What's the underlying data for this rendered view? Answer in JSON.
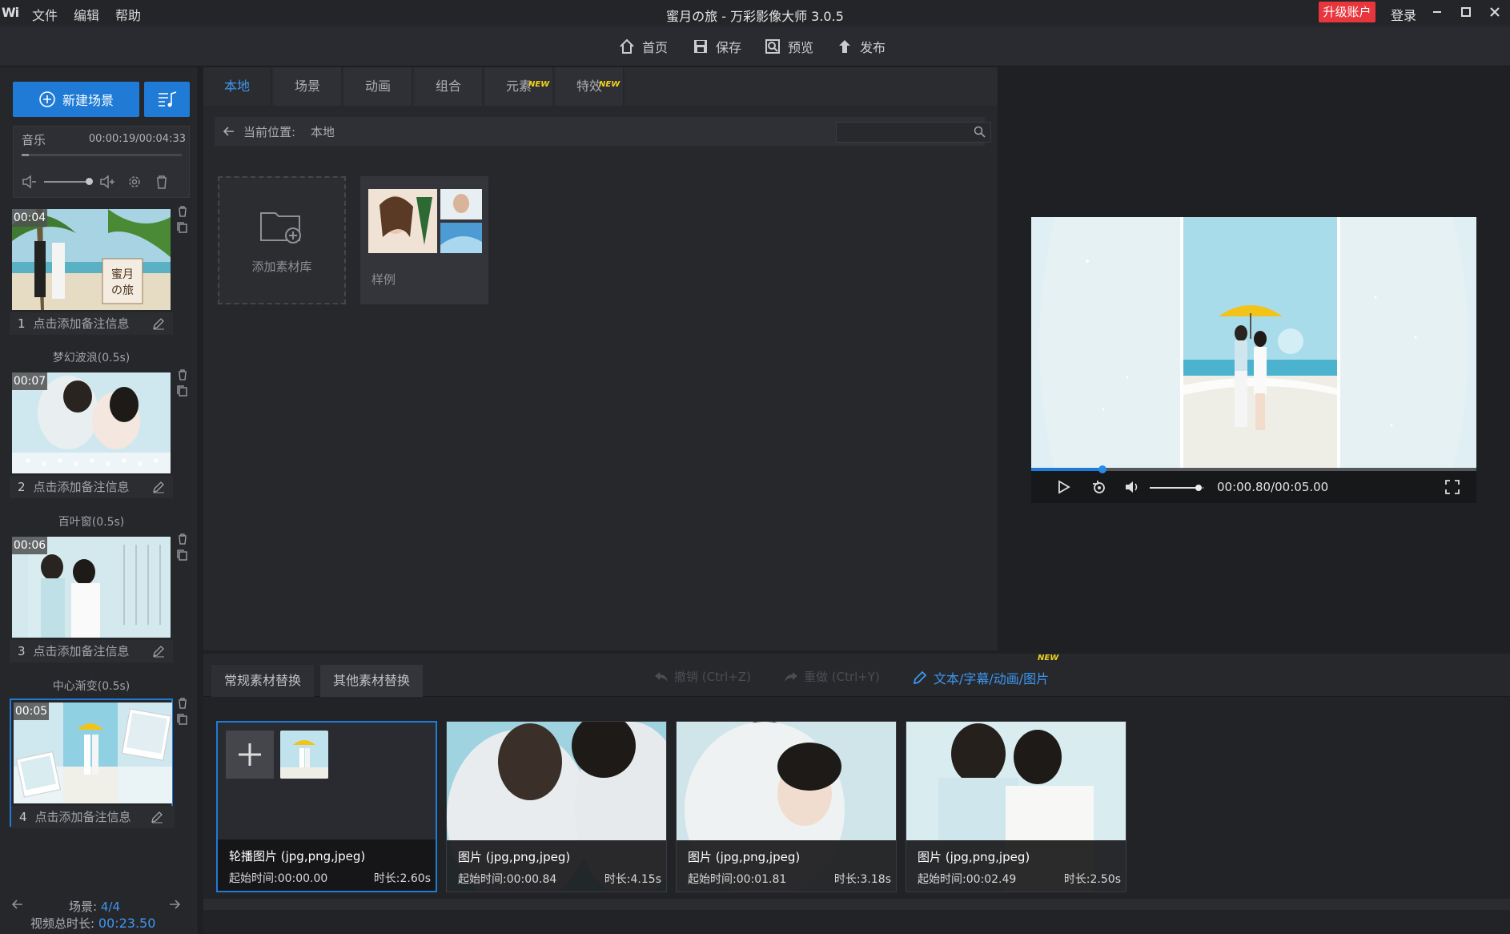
{
  "titlebar": {
    "logo": "Wi",
    "menu": [
      "文件",
      "编辑",
      "帮助"
    ],
    "title": "蜜月の旅 - 万彩影像大师 3.0.5",
    "upgrade": "升级账户",
    "login": "登录"
  },
  "toolbar": {
    "home": "首页",
    "save": "保存",
    "preview": "预览",
    "publish": "发布"
  },
  "left": {
    "new_scene": "新建场景",
    "music_label": "音乐",
    "music_time": "00:00:19/00:04:33",
    "scenes": [
      {
        "num": "1",
        "time": "00:04",
        "note": "点击添加备注信息",
        "caption": "蜜月\nの旅"
      },
      {
        "num": "2",
        "time": "00:07",
        "note": "点击添加备注信息"
      },
      {
        "num": "3",
        "time": "00:06",
        "note": "点击添加备注信息"
      },
      {
        "num": "4",
        "time": "00:05",
        "note": "点击添加备注信息"
      }
    ],
    "transitions": [
      "梦幻波浪(0.5s)",
      "百叶窗(0.5s)",
      "中心渐变(0.5s)"
    ],
    "footer_scene_label": "场景:",
    "footer_scene_value": "4/4",
    "footer_total_label": "视频总时长:",
    "footer_total_value": "00:23.50"
  },
  "center": {
    "tabs": [
      "本地",
      "场景",
      "动画",
      "组合",
      "元素",
      "特效"
    ],
    "new_badge": "NEW",
    "path_label": "当前位置:",
    "path_value": "本地",
    "search_placeholder": "",
    "add_library": "添加素材库",
    "sample": "样例"
  },
  "preview": {
    "time": "00:00.80/00:05.00",
    "progress": 0.16,
    "volume": 0.9
  },
  "bottom": {
    "tab_regular": "常规素材替换",
    "tab_other": "其他素材替换",
    "undo": "撤销 (Ctrl+Z)",
    "redo": "重做 (Ctrl+Y)",
    "text_link": "文本/字幕/动画/图片",
    "new_badge": "NEW",
    "cards": [
      {
        "title": "轮播图片 (jpg,png,jpeg)",
        "start": "起始时间:00:00.00",
        "duration": "时长:2.60s"
      },
      {
        "title": "图片 (jpg,png,jpeg)",
        "start": "起始时间:00:00.84",
        "duration": "时长:4.15s"
      },
      {
        "title": "图片 (jpg,png,jpeg)",
        "start": "起始时间:00:01.81",
        "duration": "时长:3.18s"
      },
      {
        "title": "图片 (jpg,png,jpeg)",
        "start": "起始时间:00:02.49",
        "duration": "时长:2.50s"
      }
    ]
  },
  "colors": {
    "accent": "#1f7bd6",
    "upgrade": "#e8363d",
    "badge": "#f0d21c"
  }
}
